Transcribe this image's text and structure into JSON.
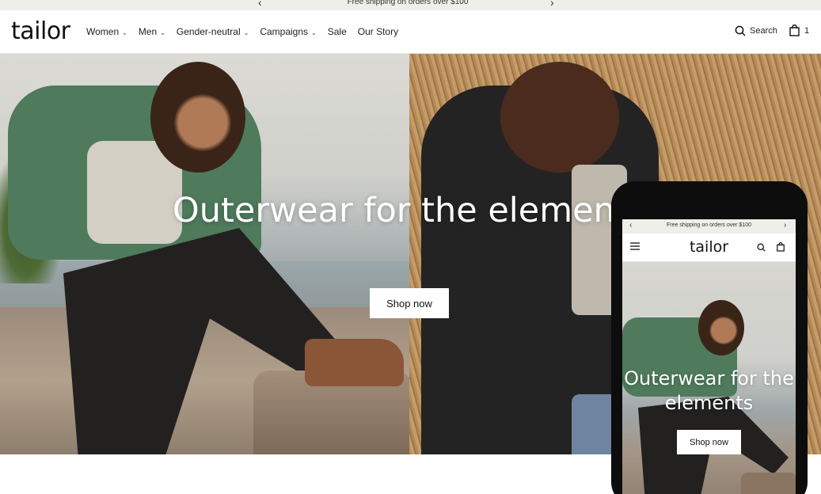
{
  "announcement": {
    "message": "Free shipping on orders over $100",
    "prev_icon": "chevron-left-icon",
    "next_icon": "chevron-right-icon"
  },
  "header": {
    "logo": "tailor",
    "nav": [
      {
        "label": "Women",
        "has_dropdown": true
      },
      {
        "label": "Men",
        "has_dropdown": true
      },
      {
        "label": "Gender-neutral",
        "has_dropdown": true
      },
      {
        "label": "Campaigns",
        "has_dropdown": true
      },
      {
        "label": "Sale",
        "has_dropdown": false
      },
      {
        "label": "Our Story",
        "has_dropdown": false
      }
    ],
    "search_label": "Search",
    "cart_count": "1"
  },
  "hero": {
    "title": "Outerwear for the elements",
    "button_label": "Shop now"
  },
  "phone_preview": {
    "announcement": "Free shipping on orders over $100",
    "logo": "tailor",
    "title": "Outerwear for the elements",
    "button_label": "Shop now"
  },
  "colors": {
    "announcement_bg": "#efeee9",
    "text": "#111111",
    "button_bg": "#ffffff"
  }
}
